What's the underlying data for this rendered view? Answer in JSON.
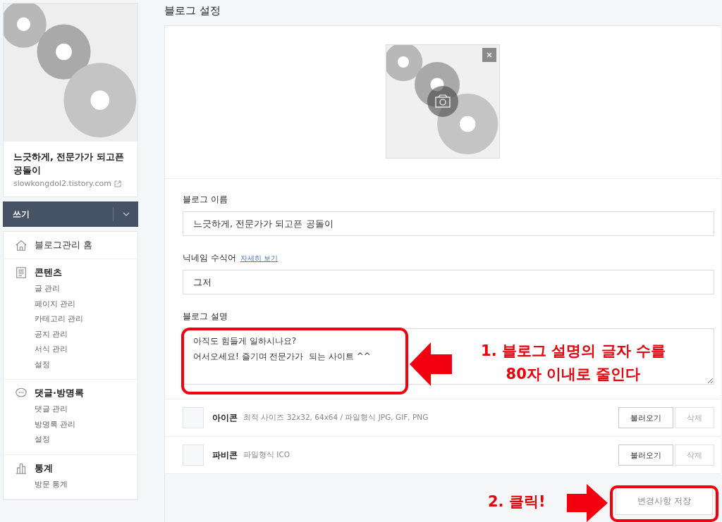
{
  "sidebar": {
    "blog_title": "느긋하게, 전문가가 되고픈 공돌이",
    "blog_url": "slowkongdol2.tistory.com",
    "write_button": "쓰기",
    "home": "블로그관리 홈",
    "sections": [
      {
        "title": "콘텐츠",
        "items": [
          "글 관리",
          "페이지 관리",
          "카테고리 관리",
          "공지 관리",
          "서식 관리",
          "설정"
        ]
      },
      {
        "title": "댓글·방명록",
        "items": [
          "댓글 관리",
          "방명록 관리",
          "설정"
        ]
      },
      {
        "title": "통계",
        "items": [
          "방문 통계"
        ]
      }
    ]
  },
  "page_title": "블로그 설정",
  "fields": [
    {
      "kind": "input",
      "label": "블로그 이름",
      "value": "느긋하게, 전문가가 되고픈 공돌이"
    },
    {
      "kind": "input",
      "label": "닉네임 수식어",
      "link": "자세히 보기",
      "value": "그저"
    },
    {
      "kind": "textarea",
      "label": "블로그 설명",
      "value": "아직도 힘들게 일하시나요?\n어서오세요! 즐기며 전문가가  되는 사이트 ^^"
    }
  ],
  "files": [
    {
      "name": "아이콘",
      "hint": "최적 사이즈 32x32, 64x64 / 파일형식 JPG, GIF, PNG",
      "load": "불러오기",
      "delete": "삭제"
    },
    {
      "name": "파비콘",
      "hint": "파일형식 ICO",
      "load": "불러오기",
      "delete": "삭제"
    }
  ],
  "save_button": "변경사항 저장",
  "annotations": [
    {
      "lines": [
        "1. 블로그 설명의 글자 수를",
        "80자 이내로 줄인다"
      ]
    },
    {
      "lines": [
        "2. 클릭!"
      ]
    }
  ]
}
